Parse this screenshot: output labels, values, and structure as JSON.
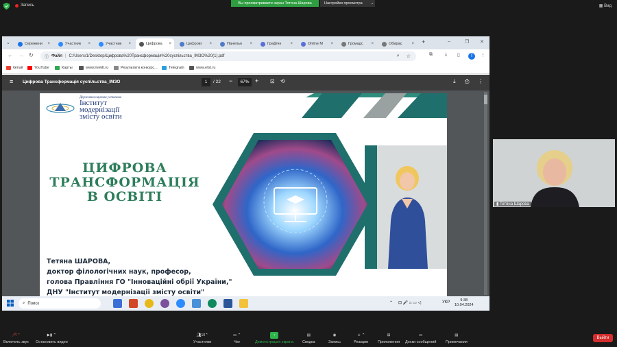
{
  "zoom_top": {
    "recording_label": "Запись",
    "share_banner": "Вы просматриваете экран Тетяна Шарова",
    "view_settings": "Настройки просмотра",
    "view_button": "Вид"
  },
  "browser": {
    "tabs": [
      {
        "label": "Сережени",
        "color": "#1a73e8"
      },
      {
        "label": "Участник",
        "color": "#2d8cff"
      },
      {
        "label": "Участник",
        "color": "#2d8cff"
      },
      {
        "label": "Цифрова",
        "color": "#555555"
      },
      {
        "label": "Цифрові",
        "color": "#4f7cc8"
      },
      {
        "label": "Панельн",
        "color": "#4f7cc8"
      },
      {
        "label": "Графічн",
        "color": "#5a6fd8"
      },
      {
        "label": "Online M",
        "color": "#5a6fd8"
      },
      {
        "label": "Громадс",
        "color": "#777777"
      },
      {
        "label": "Обирає",
        "color": "#777777"
      }
    ],
    "active_tab_index": 3,
    "address_label": "Файл",
    "url": "C:/Users/1/Desktop/Цифрова%20Трансформація%20суспільства_ІМЗО%20(1).pdf",
    "bookmarks": [
      {
        "label": "Gmail",
        "color": "#ea4335"
      },
      {
        "label": "YouTube",
        "color": "#ff0000"
      },
      {
        "label": "Карты",
        "color": "#34a853"
      },
      {
        "label": "www.liveklt.ru",
        "color": "#555555"
      },
      {
        "label": "Результати конкурс...",
        "color": "#888888"
      },
      {
        "label": "Telegram",
        "color": "#2aa1da"
      },
      {
        "label": "www.etxt.ru",
        "color": "#555555"
      }
    ]
  },
  "pdf": {
    "title": "Цифрова Трансформація суспільства_ІМЗО",
    "page_current": "1",
    "page_total": "/ 22",
    "zoom": "67%"
  },
  "slide": {
    "logo_small": "Державна наукова установа",
    "logo_line1": "Інститут",
    "logo_line2": "модернізації",
    "logo_line3": "змісту освіти",
    "title_line1": "ЦИФРОВА",
    "title_line2": "ТРАНСФОРМАЦІЯ",
    "title_line3": "В ОСВІТІ",
    "author_line1": "Тетяна ШАРОВА,",
    "author_line2": "доктор філологічних наук, професор,",
    "author_line3": "голова Правління ГО \"Інноваційні обрії України,\"",
    "author_line4": "ДНУ \"Інститут модернізації змісту освіти\""
  },
  "taskbar": {
    "search_label": "Поиск",
    "lang": "УКР",
    "time": "9:38",
    "date": "10.04.2024"
  },
  "webcam": {
    "name": "Тетяна Шарова"
  },
  "zoom_bottom": {
    "items": [
      {
        "label": "Включить звук"
      },
      {
        "label": "Остановить видео"
      },
      {
        "label": "Участники",
        "count": "10"
      },
      {
        "label": "Чат"
      },
      {
        "label": "Демонстрация экрана"
      },
      {
        "label": "Сводка"
      },
      {
        "label": "Запись"
      },
      {
        "label": "Реакции"
      },
      {
        "label": "Приложения"
      },
      {
        "label": "Доски сообщений"
      },
      {
        "label": "Примечания"
      }
    ],
    "leave_label": "Выйти"
  },
  "colors": {
    "teal": "#1f6f6c",
    "green_title": "#2e7d5b",
    "share_green": "#2f9e41",
    "leave_red": "#d32d2d"
  }
}
